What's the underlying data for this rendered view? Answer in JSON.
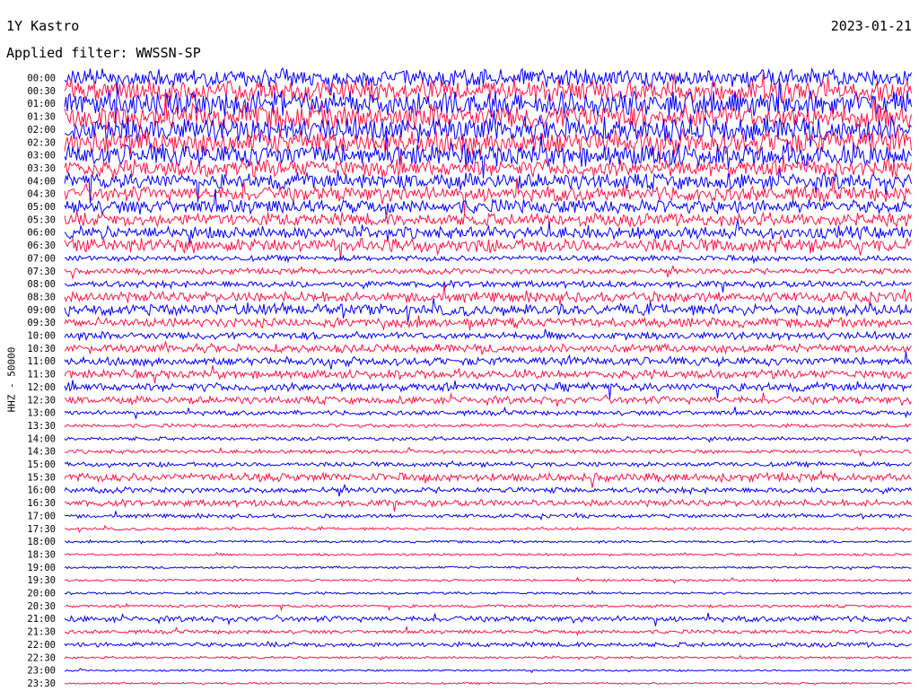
{
  "header": {
    "station": "1Y Kastro",
    "date": "2023-01-21",
    "filter": "Applied filter: WWSSN-SP"
  },
  "chart_data": {
    "type": "line",
    "title": "1Y Kastro",
    "ylabel": "HHZ - 50000",
    "colors": [
      "#0000ff",
      "#ff1744"
    ],
    "trace_labels": [
      "00:00",
      "00:30",
      "01:00",
      "01:30",
      "02:00",
      "02:30",
      "03:00",
      "03:30",
      "04:00",
      "04:30",
      "05:00",
      "05:30",
      "06:00",
      "06:30",
      "07:00",
      "07:30",
      "08:00",
      "08:30",
      "09:00",
      "09:30",
      "10:00",
      "10:30",
      "11:00",
      "11:30",
      "12:00",
      "12:30",
      "13:00",
      "13:30",
      "14:00",
      "14:30",
      "15:00",
      "15:30",
      "16:00",
      "16:30",
      "17:00",
      "17:30",
      "18:00",
      "18:30",
      "19:00",
      "19:30",
      "20:00",
      "20:30",
      "21:00",
      "21:30",
      "22:00",
      "22:30",
      "23:00",
      "23:30"
    ],
    "relative_noise_amplitude": [
      1.9,
      2.2,
      2.6,
      2.6,
      2.6,
      2.5,
      2.3,
      1.8,
      1.7,
      1.6,
      1.5,
      1.4,
      1.3,
      1.5,
      0.6,
      0.6,
      0.7,
      1.1,
      1.2,
      1.0,
      0.8,
      0.9,
      0.9,
      0.9,
      0.9,
      0.8,
      0.5,
      0.4,
      0.4,
      0.4,
      0.5,
      0.9,
      0.6,
      0.7,
      0.4,
      0.3,
      0.25,
      0.25,
      0.25,
      0.25,
      0.25,
      0.3,
      0.6,
      0.4,
      0.5,
      0.25,
      0.2,
      0.2
    ]
  }
}
